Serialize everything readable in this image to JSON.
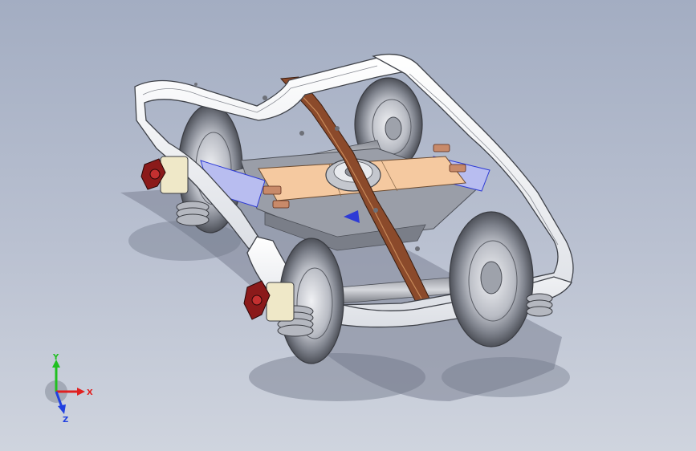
{
  "viewport": {
    "background_top": "#a3adc2",
    "background_bottom": "#cfd4de"
  },
  "model": {
    "frame_color": "#ffffff",
    "bolster_color": "#f5c9a0",
    "leaf_spring_color": "#8b4a2b",
    "wheel_color": "#c9ccd3",
    "brake_color": "#8b1a1a",
    "accent_blue": "#2e3bd6"
  },
  "triad": {
    "x_label": "X",
    "y_label": "Y",
    "z_label": "Z",
    "x_color": "#e02020",
    "y_color": "#20c020",
    "z_color": "#2040e0"
  }
}
